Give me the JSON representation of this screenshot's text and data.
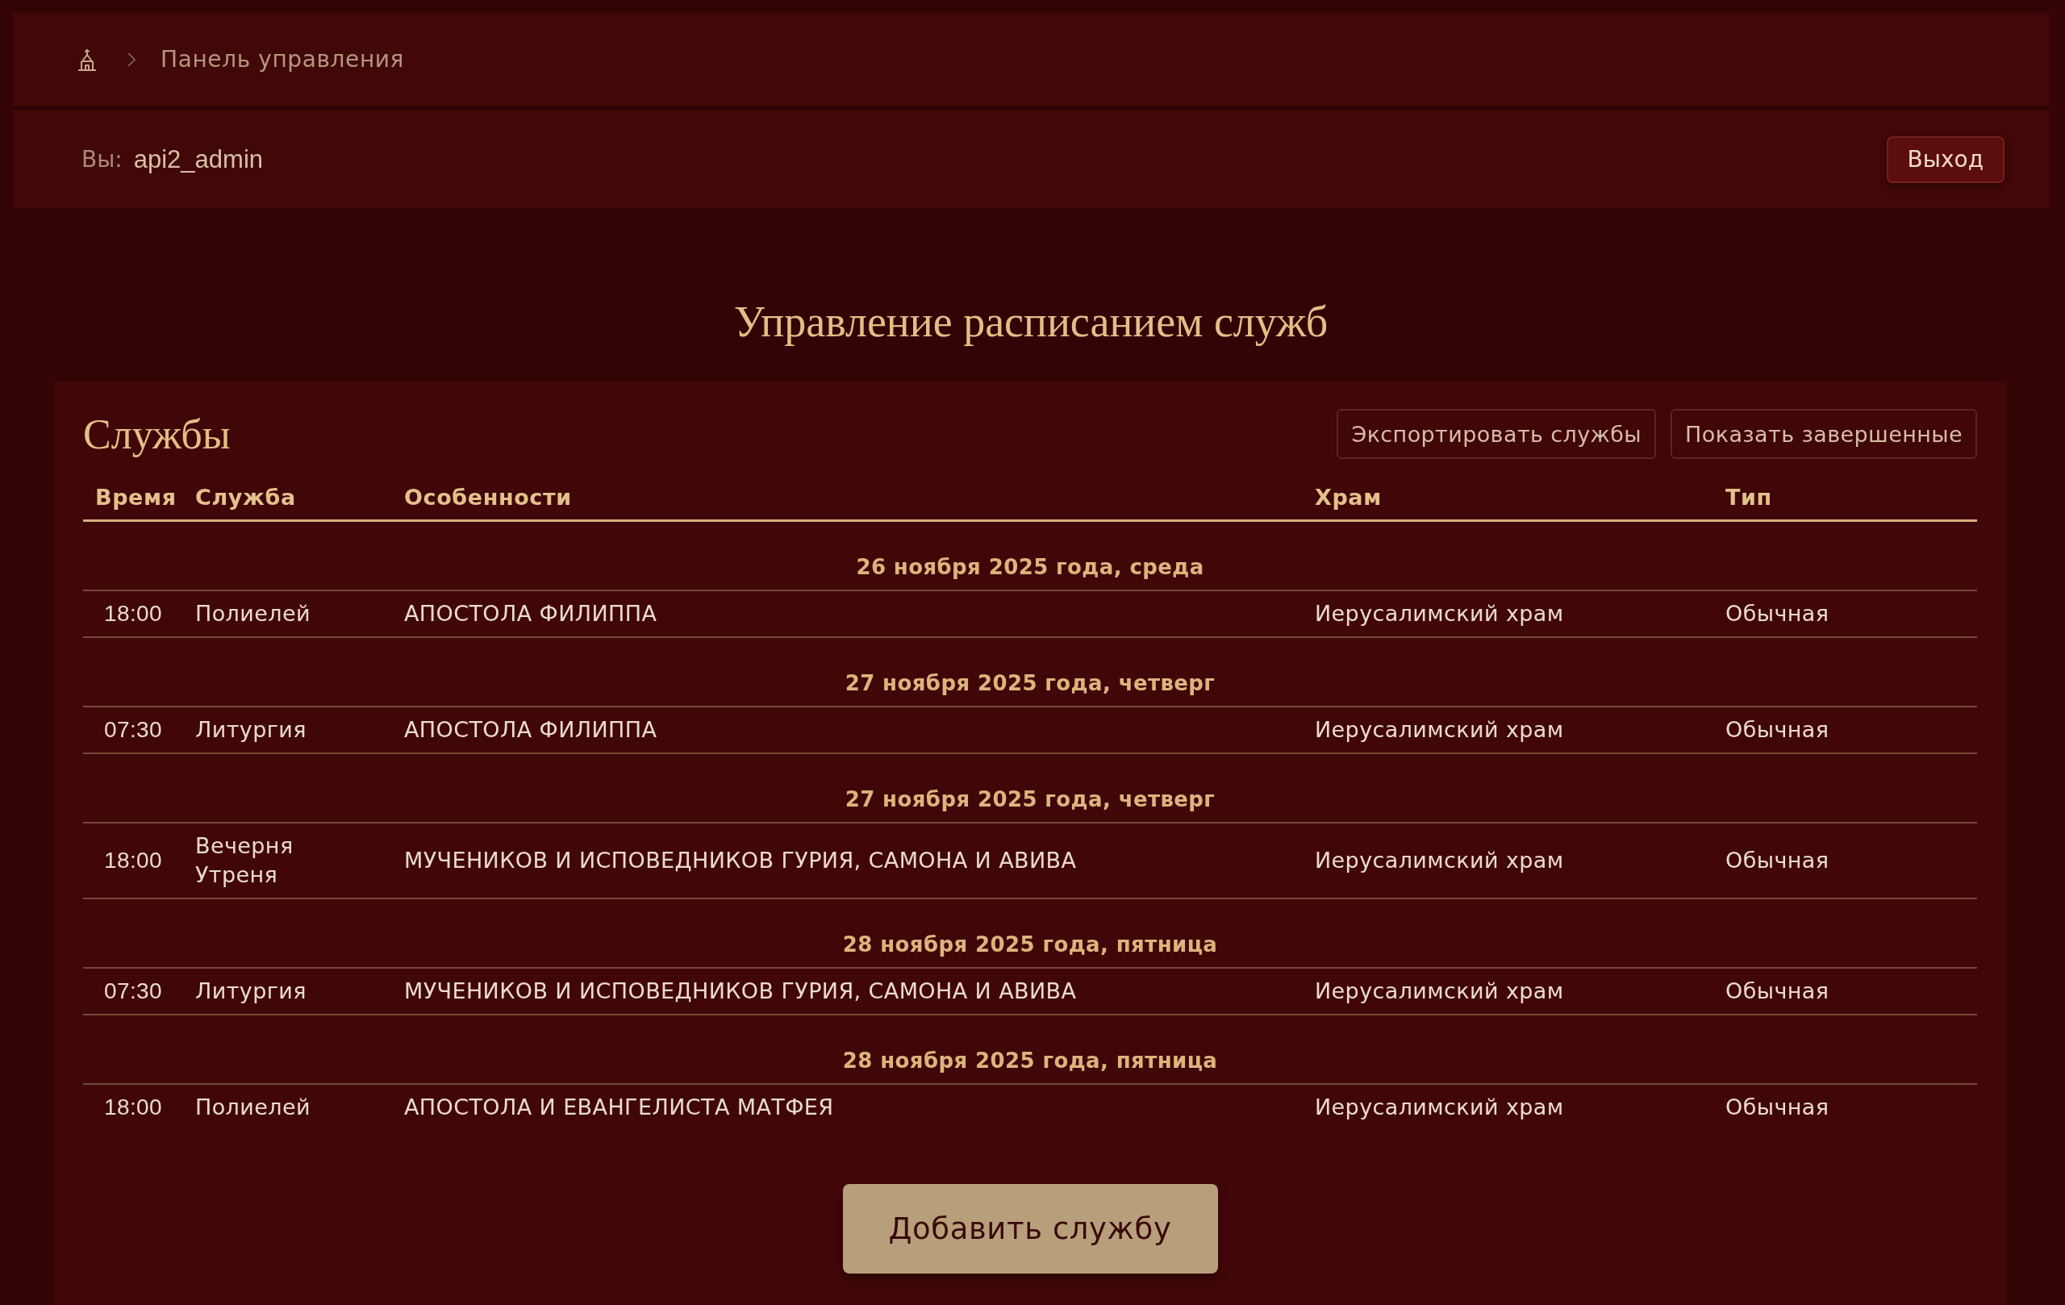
{
  "breadcrumb": {
    "current": "Панель управления"
  },
  "user_bar": {
    "label": "Вы:",
    "username": "api2_admin",
    "logout_button": "Выход"
  },
  "page_title": "Управление расписанием служб",
  "services_card": {
    "title": "Службы",
    "buttons": [
      "Экспортировать службы",
      "Показать завершенные"
    ],
    "table": {
      "columns": [
        "Время",
        "Служба",
        "Особенности",
        "Храм",
        "Тип"
      ],
      "groups": [
        {
          "date": "26 ноября 2025 года, среда",
          "rows": [
            {
              "time": "18:00",
              "service": [
                "Полиелей"
              ],
              "features": "АПОСТОЛА ФИЛИППА",
              "temple": "Иерусалимский храм",
              "type": "Обычная"
            }
          ]
        },
        {
          "date": "27 ноября 2025 года, четверг",
          "rows": [
            {
              "time": "07:30",
              "service": [
                "Литургия"
              ],
              "features": "АПОСТОЛА ФИЛИППА",
              "temple": "Иерусалимский храм",
              "type": "Обычная"
            }
          ]
        },
        {
          "date": "27 ноября 2025 года, четверг",
          "rows": [
            {
              "time": "18:00",
              "service": [
                "Вечерня",
                "Утреня"
              ],
              "features": "МУЧЕНИКОВ И ИСПОВЕДНИКОВ ГУРИЯ, САМОНА И АВИВА",
              "temple": "Иерусалимский храм",
              "type": "Обычная"
            }
          ]
        },
        {
          "date": "28 ноября 2025 года, пятница",
          "rows": [
            {
              "time": "07:30",
              "service": [
                "Литургия"
              ],
              "features": "МУЧЕНИКОВ И ИСПОВЕДНИКОВ ГУРИЯ, САМОНА И АВИВА",
              "temple": "Иерусалимский храм",
              "type": "Обычная"
            }
          ]
        },
        {
          "date": "28 ноября 2025 года, пятница",
          "rows": [
            {
              "time": "18:00",
              "service": [
                "Полиелей"
              ],
              "features": "АПОСТОЛА И ЕВАНГЕЛИСТА МАТФЕЯ",
              "temple": "Иерусалимский храм",
              "type": "Обычная"
            }
          ]
        }
      ]
    },
    "add_button": "Добавить службу"
  }
}
